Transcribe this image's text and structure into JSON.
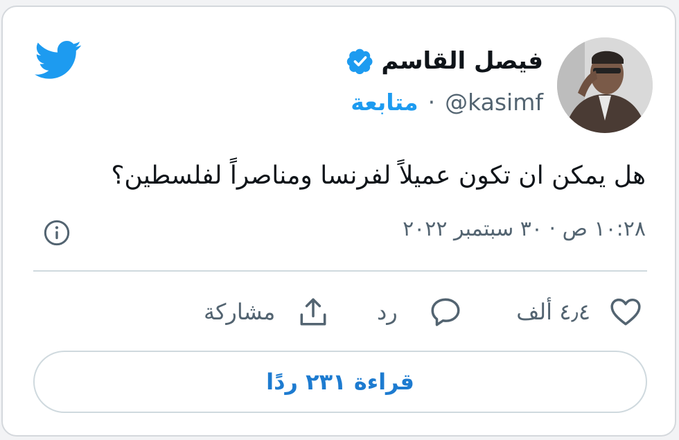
{
  "author": {
    "display_name": "فيصل القاسم",
    "handle": "@kasimf",
    "separator": "·",
    "follow_label": "متابعة"
  },
  "tweet": {
    "text": "هل يمكن ان تكون عميلاً لفرنسا ومناصراً لفلسطين؟",
    "timestamp": "١٠:٢٨ ص · ٣٠ سبتمبر ٢٠٢٢"
  },
  "actions": {
    "like_count": "٤٫٤ ألف",
    "reply_label": "رد",
    "share_label": "مشاركة"
  },
  "read_replies_label": "قراءة ٢٣١ ردًا",
  "colors": {
    "brand": "#1d9bf0",
    "link": "#1d7bd0",
    "text_primary": "#0f1419",
    "text_secondary": "#536471",
    "border": "#cfd9de"
  },
  "icons": [
    "twitter-bird-icon",
    "verified-badge-icon",
    "info-icon",
    "heart-icon",
    "reply-bubble-icon",
    "share-icon"
  ]
}
